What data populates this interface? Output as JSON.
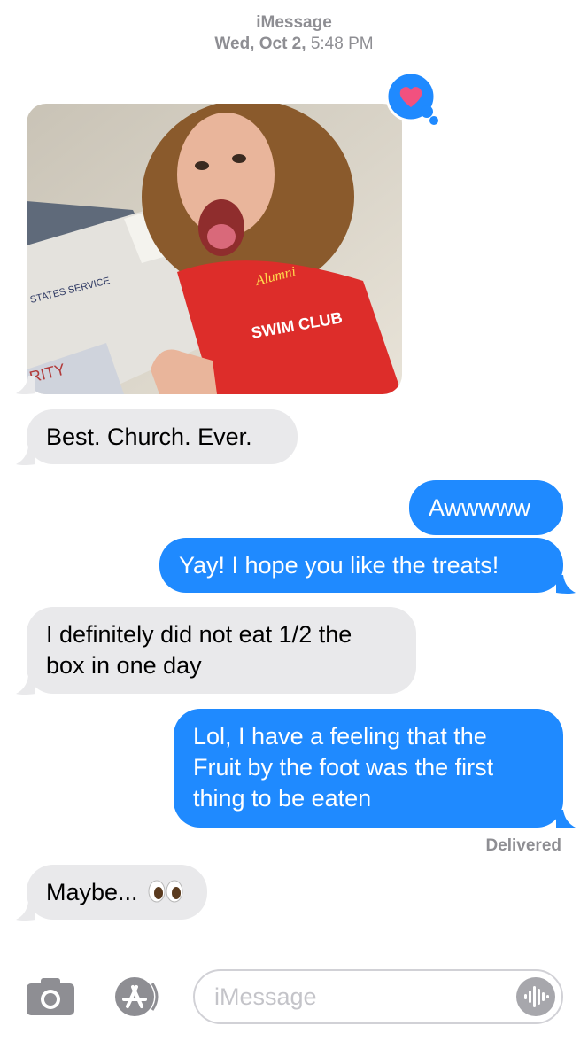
{
  "header": {
    "service": "iMessage",
    "day": "Wed, Oct 2,",
    "time": "5:48 PM"
  },
  "tapback": {
    "icon": "heart-icon",
    "color": "#f2517f"
  },
  "messages": [
    {
      "type": "photo",
      "direction": "in",
      "icon": "selfie-photo"
    },
    {
      "direction": "in",
      "text": "Best. Church. Ever."
    },
    {
      "direction": "out",
      "text": "Awwwww"
    },
    {
      "direction": "out",
      "text": "Yay! I hope you like the treats!"
    },
    {
      "direction": "in",
      "lines": [
        "I definitely did not eat 1/2 the",
        "box in one day"
      ]
    },
    {
      "direction": "out",
      "lines": [
        "Lol, I have a feeling that the",
        "Fruit by the foot was the first",
        "thing to be eaten"
      ]
    },
    {
      "direction": "in",
      "text": "Maybe...",
      "emoji": "eyes-icon"
    }
  ],
  "status": "Delivered",
  "composer": {
    "placeholder": "iMessage"
  },
  "colors": {
    "outgoing": "#1f8aff",
    "incoming": "#e9e9eb",
    "meta": "#8e8e93"
  }
}
